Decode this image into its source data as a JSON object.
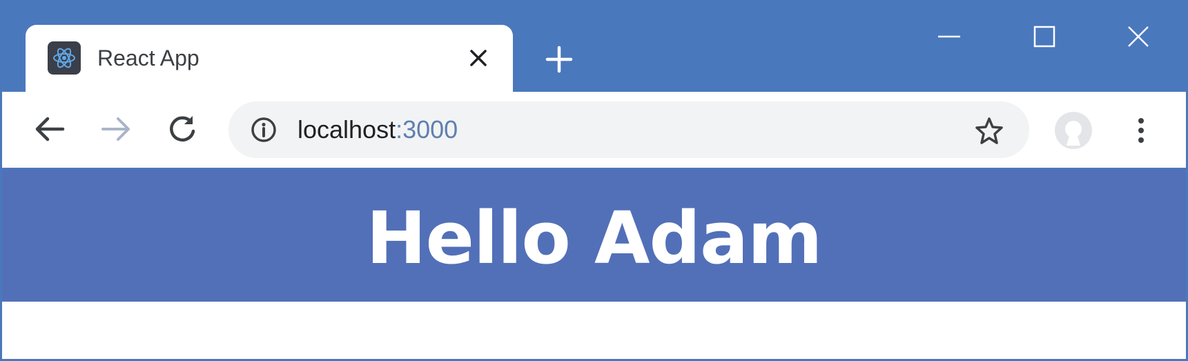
{
  "browser": {
    "tab": {
      "title": "React App",
      "favicon": "react-icon"
    },
    "new_tab_icon": "plus-icon",
    "window_controls": [
      "minimize-icon",
      "maximize-icon",
      "close-icon"
    ],
    "toolbar": {
      "back_icon": "back-arrow-icon",
      "forward_icon": "forward-arrow-icon",
      "reload_icon": "reload-icon",
      "url_host": "localhost",
      "url_port": ":3000",
      "info_icon": "info-icon",
      "bookmark_icon": "star-icon",
      "profile_icon": "avatar-icon",
      "menu_icon": "kebab-menu-icon"
    }
  },
  "page": {
    "heading": "Hello Adam"
  },
  "colors": {
    "chrome_frame": "#4a78bd",
    "banner": "#5270b8",
    "omnibox_bg": "#f1f3f4",
    "text_white": "#ffffff"
  }
}
